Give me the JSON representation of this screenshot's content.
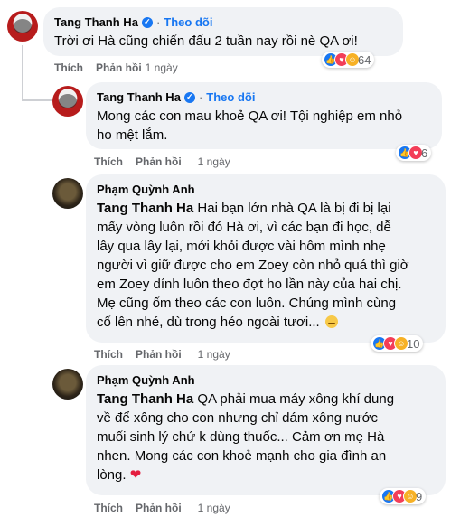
{
  "comments": [
    {
      "author": "Tang Thanh Ha",
      "verified": true,
      "follow_label": "Theo dõi",
      "text": "Trời ơi Hà cũng chiến đấu 2 tuần nay rồi nè QA ơi!",
      "like_label": "Thích",
      "reply_label": "Phản hồi",
      "time": "1 ngày",
      "reaction_count": "64"
    },
    {
      "author": "Tang Thanh Ha",
      "verified": true,
      "follow_label": "Theo dõi",
      "text_lines": [
        "Mong các con mau khoẻ QA ơi! Tội nghiệp em nhỏ",
        "ho mệt lắm."
      ],
      "like_label": "Thích",
      "reply_label": "Phản hồi",
      "time": "1 ngày",
      "reaction_count": "6"
    },
    {
      "author": "Phạm Quỳnh Anh",
      "mention": "Tang Thanh Ha",
      "text_lines": [
        " Hai bạn lớn nhà QA là bị đi bị lại",
        "mấy vòng luôn rồi đó Hà ơi, vì các bạn đi học, dễ",
        "lây qua lây lại, mới khỏi được vài hôm mình nhẹ",
        "người vì giữ được cho em Zoey còn nhỏ quá thì giờ",
        "em Zoey dính luôn theo đợt ho lần này của hai chị.",
        "Mẹ cũng ốm theo các con luôn. Chúng mình cùng",
        "cố lên nhé, dù trong héo ngoài tươi..."
      ],
      "like_label": "Thích",
      "reply_label": "Phản hồi",
      "time": "1 ngày",
      "reaction_count": "10"
    },
    {
      "author": "Phạm Quỳnh Anh",
      "mention": "Tang Thanh Ha",
      "text_lines": [
        " QA phải mua máy xông khí dung",
        "về để xông cho con nhưng chỉ dám xông nước",
        "muối sinh lý chứ k dùng thuốc... Cảm ơn mẹ Hà",
        "nhen. Mong các con khoẻ mạnh cho gia đình an",
        "lòng. "
      ],
      "like_label": "Thích",
      "reply_label": "Phản hồi",
      "time": "1 ngày",
      "reaction_count": "9"
    }
  ],
  "colors": {
    "accent": "#1877f2",
    "bubble": "#f0f2f5",
    "muted": "#65676b",
    "love": "#f33e58",
    "care": "#f7b125"
  },
  "icons": [
    "verified-badge-icon",
    "like-reaction-icon",
    "love-reaction-icon",
    "care-reaction-icon",
    "sweat-smile-emoji-icon",
    "red-heart-emoji-icon"
  ]
}
